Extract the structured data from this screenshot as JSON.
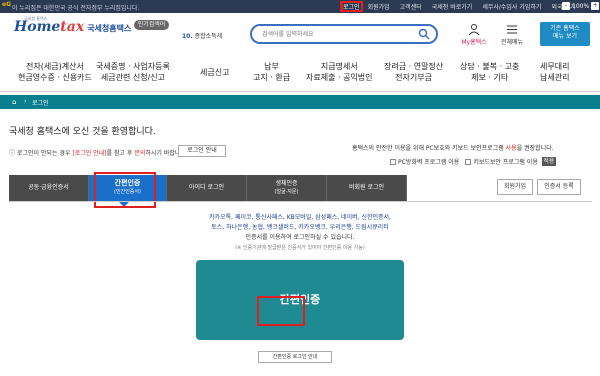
{
  "topbar": {
    "egov": "eG",
    "notice": "이 누리집은 대한민국 공식 전자정부 누리집입니다.",
    "links": [
      "로그인",
      "회원가입",
      "고객센터",
      "국세청 바로가기",
      "세무사/수임사 가입하기",
      "외국어 기"
    ],
    "zoom_value": "100%",
    "zoom_minus": "-",
    "zoom_plus": "+"
  },
  "header": {
    "logo_tiny": "국세청 홈택스",
    "logo_main_a": "Home",
    "logo_main_b": "tax",
    "logo_sub": "국세청홈택스",
    "popular_label": "인기검색어",
    "rank_num": "10.",
    "rank_text": "종합소득세",
    "search_placeholder": "검색어를 입력하세요",
    "myhome_label": "My홈택스",
    "allmenu_label": "전체메뉴",
    "oldmenu_line1": "기존 홈택스",
    "oldmenu_line2": "메뉴 보기"
  },
  "gnb": {
    "items": [
      {
        "line1": "전자(세금)계산서",
        "line2": "현금영수증 · 신용카드"
      },
      {
        "line1": "국세증명 · 사업자등록",
        "line2": "세금관련 신청/신고"
      },
      {
        "line1": "세금신고",
        "line2": ""
      },
      {
        "line1": "납부",
        "line2": "고지 · 환급"
      },
      {
        "line1": "지급명세서",
        "line2": "자료제출 · 공익법인"
      },
      {
        "line1": "장려금 · 연말정산",
        "line2": "전자기부금"
      },
      {
        "line1": "상담 · 불복 · 고충",
        "line2": "제보 · 기타"
      },
      {
        "line1": "세무대리",
        "line2": "납세관리"
      }
    ]
  },
  "crumb": {
    "home": "⌂",
    "sep": "›",
    "label": "로그인"
  },
  "welcome": "국세청 홈택스에 오신 것을 환영합니다.",
  "info_left": {
    "a": "로그인이 안되는 경우 ",
    "red": "[로그인 안내]",
    "b": "를 참고 후 ",
    "red2": "문의",
    "c": "하시기 바랍니다."
  },
  "guide_button": "로그인 안내",
  "info_right": {
    "a": "홈택스의 안전한 이용을 위해 PC보호와 키보드 보안프로그램 ",
    "red": "사용",
    "b": "을 권장합니다."
  },
  "secure": {
    "pc": "PC방화벽 프로그램 이용",
    "kb": "키보드보안 프로그램 이용",
    "apply": "적용"
  },
  "tabs": [
    {
      "label": "공동·금융인증서"
    },
    {
      "label": "간편인증",
      "sub": "(민간인증서)"
    },
    {
      "label": "아이디 로그인"
    },
    {
      "label": "생체인증",
      "sub": "(얼굴·지문)"
    },
    {
      "label": "비회원 로그인"
    }
  ],
  "right_buttons": {
    "join": "회원가입",
    "register": "인증서 등록"
  },
  "providers": {
    "line1": "카카오톡, 페이코, 통신사패스, KB모바일, 삼성패스, 네이버, 신한인증서,",
    "line2": "토스, 하나은행, 농협, 뱅크샐러드, 카카오뱅크, 우리은행, 드림시큐리티",
    "line3": "인증서를 이용하여 로그인하실 수 있습니다.",
    "note": "(※ 인증기관에 발급받은 인증서가 있어야 간편인증 이용 가능)"
  },
  "big_button": "간편인증",
  "howto_button": "간편인증 로그인 안내"
}
